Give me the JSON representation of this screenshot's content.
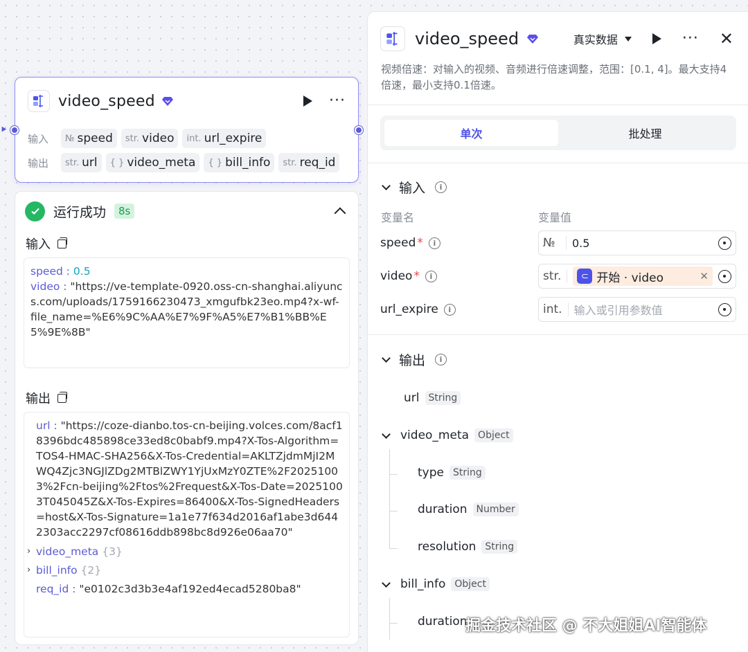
{
  "node": {
    "title": "video_speed",
    "input_label": "输入",
    "output_label": "输出",
    "inputs": [
      {
        "type": "№",
        "name": "speed"
      },
      {
        "type": "str.",
        "name": "video"
      },
      {
        "type": "int.",
        "name": "url_expire"
      }
    ],
    "outputs": [
      {
        "type": "str.",
        "name": "url"
      },
      {
        "type": "{ }",
        "name": "video_meta"
      },
      {
        "type": "{ }",
        "name": "bill_info"
      },
      {
        "type": "str.",
        "name": "req_id"
      }
    ]
  },
  "run": {
    "status": "运行成功",
    "time": "8s",
    "input_title": "输入",
    "output_title": "输出",
    "input": {
      "speed_key": "speed",
      "speed_value": "0.5",
      "video_key": "video",
      "video_value": "\"https://ve-template-0920.oss-cn-shanghai.aliyuncs.com/uploads/1759166230473_xmgufbk23eo.mp4?x-wf-file_name=%E6%9C%AA%E7%9F%A5%E7%B1%BB%E5%9E%8B\""
    },
    "output": {
      "url_key": "url",
      "url_value": "\"https://coze-dianbo.tos-cn-beijing.volces.com/8acf18396bdc485898ce33ed8c0babf9.mp4?X-Tos-Algorithm=TOS4-HMAC-SHA256&X-Tos-Credential=AKLTZjdmMjI2MWQ4Zjc3NGJlZDg2MTBlZWY1YjUxMzY0ZTE%2F20251003%2Fcn-beijing%2Ftos%2Frequest&X-Tos-Date=20251003T045045Z&X-Tos-Expires=86400&X-Tos-SignedHeaders=host&X-Tos-Signature=1a1e77f634d2016af1abe3d6442303acc2297cf08616ddb898bc8d926e06aa70\"",
      "video_meta_key": "video_meta",
      "video_meta_count": "{3}",
      "bill_info_key": "bill_info",
      "bill_info_count": "{2}",
      "req_id_key": "req_id",
      "req_id_value": "\"e0102c3d3b3e4af192ed4ecad5280ba8\""
    }
  },
  "panel": {
    "title": "video_speed",
    "data_mode": "真实数据",
    "description": "视频倍速：对输入的视频、音频进行倍速调整，范围：[0.1, 4]。最大支持4倍速，最小支持0.1倍速。",
    "tab_single": "单次",
    "tab_batch": "批处理",
    "input_group": "输入",
    "col_name": "变量名",
    "col_value": "变量值",
    "params": {
      "speed": {
        "name": "speed",
        "type": "№",
        "value": "0.5"
      },
      "video": {
        "name": "video",
        "type": "str.",
        "ref": "开始 · video"
      },
      "url_expire": {
        "name": "url_expire",
        "type": "int.",
        "placeholder": "输入或引用参数值"
      }
    },
    "output_group": "输出",
    "outputs": {
      "url": {
        "name": "url",
        "type": "String"
      },
      "video_meta": {
        "name": "video_meta",
        "type": "Object"
      },
      "type": {
        "name": "type",
        "type": "String"
      },
      "duration": {
        "name": "duration",
        "type": "Number"
      },
      "resolution": {
        "name": "resolution",
        "type": "String"
      },
      "bill_info": {
        "name": "bill_info",
        "type": "Object"
      },
      "bill_duration": {
        "name": "duration"
      }
    }
  },
  "watermark": "掘金技术社区 @ 不大姐姐AI智能体",
  "colors": {
    "accent": "#4d53e8",
    "success": "#25b864",
    "border_active": "#8f8cf8"
  }
}
